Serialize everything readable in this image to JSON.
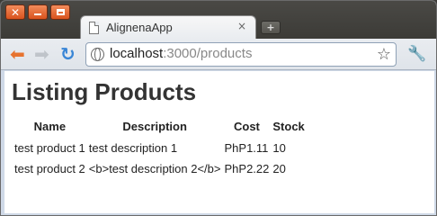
{
  "browser": {
    "tab_title": "AlignenaApp",
    "tab_close": "×",
    "new_tab": "+",
    "url_host": "localhost",
    "url_rest": ":3000/products"
  },
  "page": {
    "heading": "Listing Products",
    "columns": [
      "Name",
      "Description",
      "Cost",
      "Stock"
    ],
    "rows": [
      [
        "test product 1",
        "test description 1",
        "PhP1.11",
        "10"
      ],
      [
        "test product 2",
        "<b>test description 2</b>",
        "PhP2.22",
        "20"
      ]
    ]
  },
  "colors": {
    "window_button": "#e95f24",
    "titlebar": "#3c3b37",
    "back_arrow": "#e7732f",
    "reload": "#3a86d6"
  },
  "icons": [
    "close-icon",
    "minimize-icon",
    "maximize-icon",
    "document-icon",
    "back-arrow-icon",
    "forward-arrow-icon",
    "reload-icon",
    "globe-icon",
    "star-icon",
    "wrench-icon"
  ]
}
